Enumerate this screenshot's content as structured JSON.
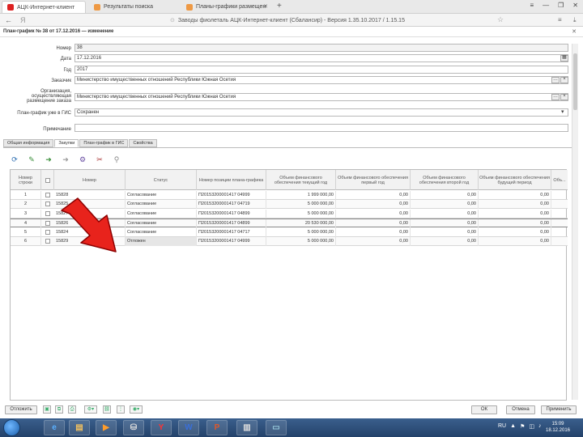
{
  "browser": {
    "tabs": [
      {
        "label": "АЦК-Интернет-клиент",
        "active": true,
        "favicon_color": "#d22"
      },
      {
        "label": "Результаты поиска",
        "active": false,
        "favicon_color": "#e94"
      },
      {
        "label": "Планы-графики размещен",
        "active": false,
        "favicon_color": "#e94"
      }
    ],
    "new_tab": "+",
    "window_controls": [
      "≡",
      "—",
      "❐",
      "✕"
    ],
    "back": "←",
    "yandex": "Я",
    "url": "Заводы фиолеталь АЦК-Интернет-клиент (Сбалансир) - Версия 1.35.10.2017 / 1.15.15",
    "bookmark": "☆",
    "menu": "≡",
    "download": "⤓"
  },
  "document": {
    "title": "План-график № 38 от 17.12.2016 — изменение",
    "close": "✕"
  },
  "form": {
    "number_label": "Номер",
    "number_value": "38",
    "date_label": "Дата",
    "date_value": "17.12.2016",
    "year_label": "Год",
    "year_value": "2017",
    "customer_label": "Заказчик",
    "customer_value": "Министерство имущественных отношений Республики Южная Осетия",
    "org_label": "Организация, осуществляющая размещение заказа",
    "org_value": "Министерство имущественных отношений Республики Южная Осетия",
    "mode_label": "План-график уже в ГИС",
    "mode_value": "Сохранен",
    "note_label": "Примечание",
    "note_value": ""
  },
  "subtabs": [
    {
      "label": "Общая информация",
      "active": false
    },
    {
      "label": "Закупки",
      "active": true
    },
    {
      "label": "План-график в ГИС",
      "active": false
    },
    {
      "label": "Свойства",
      "active": false
    }
  ],
  "toolbar": {
    "icons": [
      {
        "name": "refresh-icon",
        "glyph": "⟳",
        "color": "#2b6cb0"
      },
      {
        "name": "edit-icon",
        "glyph": "✎",
        "color": "#3a8f3a"
      },
      {
        "name": "move-down-icon",
        "glyph": "➜",
        "color": "#3a8f3a"
      },
      {
        "name": "move-up-icon",
        "glyph": "➜",
        "color": "#999"
      },
      {
        "name": "settings-icon",
        "glyph": "⚙",
        "color": "#6a4fa3"
      },
      {
        "name": "tools-icon",
        "glyph": "✂",
        "color": "#a33"
      },
      {
        "name": "filter-icon",
        "glyph": "⚲",
        "color": "#888"
      }
    ]
  },
  "table": {
    "columns": [
      "Номер строки",
      "",
      "Номер",
      "Статус",
      "Номер позиции плана-графика",
      "Объем финансового обеспечения текущий год",
      "Объем финансового обеспечения первый год",
      "Объем финансового обеспечения второй год",
      "Объем финансового обеспечения будущий период",
      "Объ..."
    ],
    "rows": [
      {
        "line": "1",
        "num": "15828",
        "status": "Согласование",
        "pos": "П20153200001417 04999",
        "v1": "1 999 000,00",
        "v2": "0,00",
        "v3": "0,00",
        "v4": "0,00"
      },
      {
        "line": "2",
        "num": "15825",
        "status": "Согласование",
        "pos": "П20153200001417 04719",
        "v1": "5 000 000,00",
        "v2": "0,00",
        "v3": "0,00",
        "v4": "0,00"
      },
      {
        "line": "3",
        "num": "15827",
        "status": "Согласование",
        "pos": "П20153200001417 04899",
        "v1": "5 000 000,00",
        "v2": "0,00",
        "v3": "0,00",
        "v4": "0,00"
      },
      {
        "line": "4",
        "num": "15826",
        "status": "Согласование",
        "pos": "П20153200001417 04899",
        "v1": "20 530 000,00",
        "v2": "0,00",
        "v3": "0,00",
        "v4": "0,00"
      },
      {
        "line": "5",
        "num": "15824",
        "status": "Согласование",
        "pos": "П20153200001417 04717",
        "v1": "5 000 000,00",
        "v2": "0,00",
        "v3": "0,00",
        "v4": "0,00"
      },
      {
        "line": "6",
        "num": "15829",
        "status": "Отложен",
        "pos": "П20153200001417 04999",
        "v1": "5 000 000,00",
        "v2": "0,00",
        "v3": "0,00",
        "v4": "0,00"
      }
    ]
  },
  "bottom": {
    "action_label": "Отложить",
    "ok_label": "ОК",
    "cancel_label": "Отмена",
    "apply_label": "Применить"
  },
  "taskbar": {
    "apps": [
      {
        "name": "ie-icon",
        "glyph": "e",
        "color": "#5ab0ff"
      },
      {
        "name": "explorer-icon",
        "glyph": "▤",
        "color": "#f0c060"
      },
      {
        "name": "media-icon",
        "glyph": "▶",
        "color": "#ff9c2a"
      },
      {
        "name": "network-icon",
        "glyph": "⛁",
        "color": "#ddd"
      },
      {
        "name": "yandex-browser-icon",
        "glyph": "Y",
        "color": "#ff3333"
      },
      {
        "name": "word-icon",
        "glyph": "W",
        "color": "#3a6fd8"
      },
      {
        "name": "powerpoint-icon",
        "glyph": "P",
        "color": "#e0582a"
      },
      {
        "name": "archive-icon",
        "glyph": "▥",
        "color": "#ddd"
      },
      {
        "name": "window-icon",
        "glyph": "▭",
        "color": "#9cd"
      }
    ],
    "tray": [
      "RU",
      "▲",
      "⚑",
      "◫",
      "♪"
    ],
    "time": "15:09",
    "date": "18.12.2016"
  }
}
